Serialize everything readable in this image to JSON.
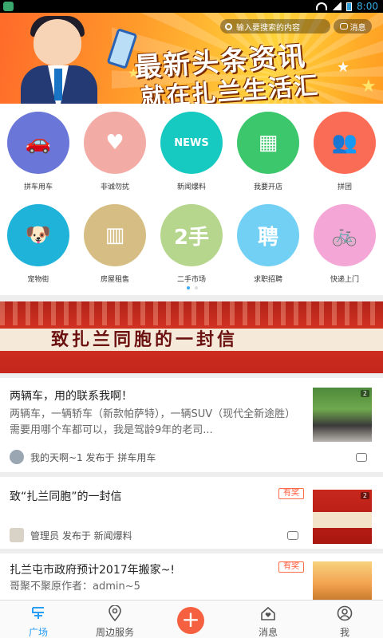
{
  "status_bar": {
    "time": "8:00"
  },
  "banner": {
    "search_placeholder": "输入要搜索的内容",
    "messages_label": "消息",
    "headline_line1": "最新头条资讯",
    "headline_line2": "就在扎兰生活汇"
  },
  "categories": [
    {
      "label": "拼车用车",
      "color": "#6a76d8",
      "icon": "car-icon"
    },
    {
      "label": "非诚勿扰",
      "color": "#f3aba5",
      "icon": "hearts-icon"
    },
    {
      "label": "新闻爆料",
      "color": "#16c9c1",
      "icon": "news-icon"
    },
    {
      "label": "我要开店",
      "color": "#3cc76c",
      "icon": "store-icon"
    },
    {
      "label": "拼团",
      "color": "#fa6c55",
      "icon": "group-icon"
    },
    {
      "label": "宠物街",
      "color": "#20b3da",
      "icon": "dog-icon"
    },
    {
      "label": "房屋租售",
      "color": "#d6bd84",
      "icon": "buildings-icon"
    },
    {
      "label": "二手市场",
      "color": "#b5d68c",
      "icon": "secondhand-icon"
    },
    {
      "label": "求职招聘",
      "color": "#72d0f5",
      "icon": "hire-icon"
    },
    {
      "label": "快递上门",
      "color": "#f4a6d6",
      "icon": "delivery-icon"
    }
  ],
  "category_glyphs": [
    "🚗",
    "♥",
    "NEWS",
    "▦",
    "👥",
    "🐶",
    "▥",
    "2手",
    "聘",
    "🚲"
  ],
  "letter_banner": {
    "text": "致扎兰同胞的一封信"
  },
  "posts": [
    {
      "title": "两辆车，用的联系我啊！",
      "body": "两辆车，一辆轿车（新款帕萨特），一辆SUV（现代全新途胜）需要用哪个车都可以，我是驾龄9年的老司...",
      "author_line": "我的天啊~1 发布于 拼车用车",
      "image_count": "2"
    },
    {
      "title": "致“扎兰同胞”的一封信",
      "award": "有奖",
      "author_line": "管理员 发布于 新闻爆料",
      "image_count": "2"
    },
    {
      "title": "扎兰屯市政府预计2017年搬家~!",
      "award": "有奖",
      "body": "哥聚不聚原作者：admin~5"
    }
  ],
  "nav": {
    "tabs": [
      {
        "label": "广场",
        "active": true
      },
      {
        "label": "周边服务",
        "active": false
      },
      {
        "label": "消息",
        "active": false
      },
      {
        "label": "我",
        "active": false
      }
    ],
    "add_symbol": "+"
  }
}
